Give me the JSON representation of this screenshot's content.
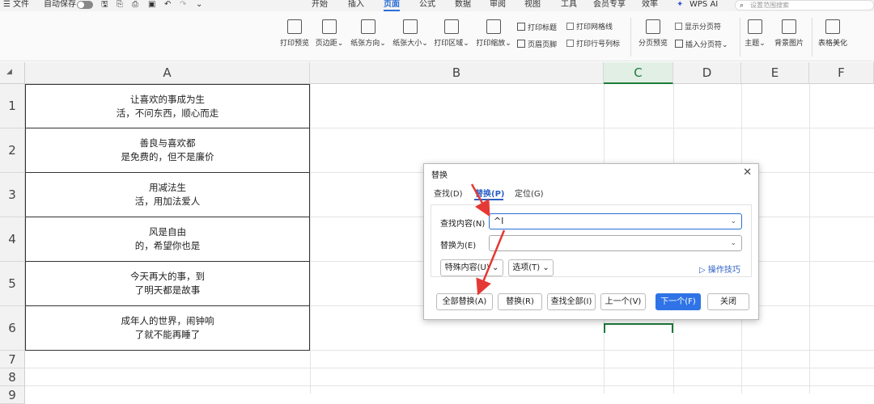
{
  "menubar": {
    "file_label": "文件",
    "autosave_label": "自动保存",
    "tabs": [
      "开始",
      "插入",
      "页面",
      "公式",
      "数据",
      "审阅",
      "视图",
      "工具",
      "会员专享",
      "效率"
    ],
    "active_tab": "页面",
    "wps_ai_label": "WPS AI",
    "search_placeholder": "设置范围搜索"
  },
  "ribbon": {
    "buttons": [
      "打印预览",
      "页边距",
      "纸张方向",
      "纸张大小",
      "打印区域",
      "打印缩放",
      "分页预览",
      "主题",
      "背景图片",
      "表格美化"
    ],
    "small": {
      "print_title": "打印标题",
      "header_footer": "页眉页脚",
      "print_gridlines": "打印网格线",
      "print_row_col": "打印行号列标",
      "show_page_break": "显示分页符",
      "insert_page_break": "插入分页符"
    }
  },
  "sheet": {
    "columns": [
      "A",
      "B",
      "C",
      "D",
      "E",
      "F"
    ],
    "selected_column": "C",
    "rows": [
      "1",
      "2",
      "3",
      "4",
      "5",
      "6",
      "7",
      "8",
      "9"
    ],
    "cells_A": [
      {
        "line1": "让喜欢的事成为生",
        "line2": "活，不问东西，顺心而走"
      },
      {
        "line1": "善良与喜欢都",
        "line2": "是免费的，但不是廉价"
      },
      {
        "line1": "用减法生",
        "line2": "活，用加法爱人"
      },
      {
        "line1": "风是自由",
        "line2": "的，希望你也是"
      },
      {
        "line1": "今天再大的事，到",
        "line2": "了明天都是故事"
      },
      {
        "line1": "成年人的世界，闹钟响",
        "line2": "了就不能再睡了"
      }
    ]
  },
  "dialog": {
    "title": "替换",
    "tabs": [
      "查找(D)",
      "替换(P)",
      "定位(G)"
    ],
    "active_tab": "替换(P)",
    "find_label": "查找内容(N)",
    "find_value": "^l",
    "replace_label": "替换为(E)",
    "replace_value": "",
    "special_label": "特殊内容(U)",
    "options_label": "选项(T)",
    "tips_label": "操作技巧",
    "buttons": [
      "全部替换(A)",
      "替换(R)",
      "查找全部(I)",
      "上一个(V)",
      "下一个(F)",
      "关闭"
    ]
  },
  "colors": {
    "accent": "#2b6fd6",
    "primary_button": "#2f73e6",
    "selection_green": "#1d7a3a",
    "annotation_arrow": "#e53935"
  }
}
